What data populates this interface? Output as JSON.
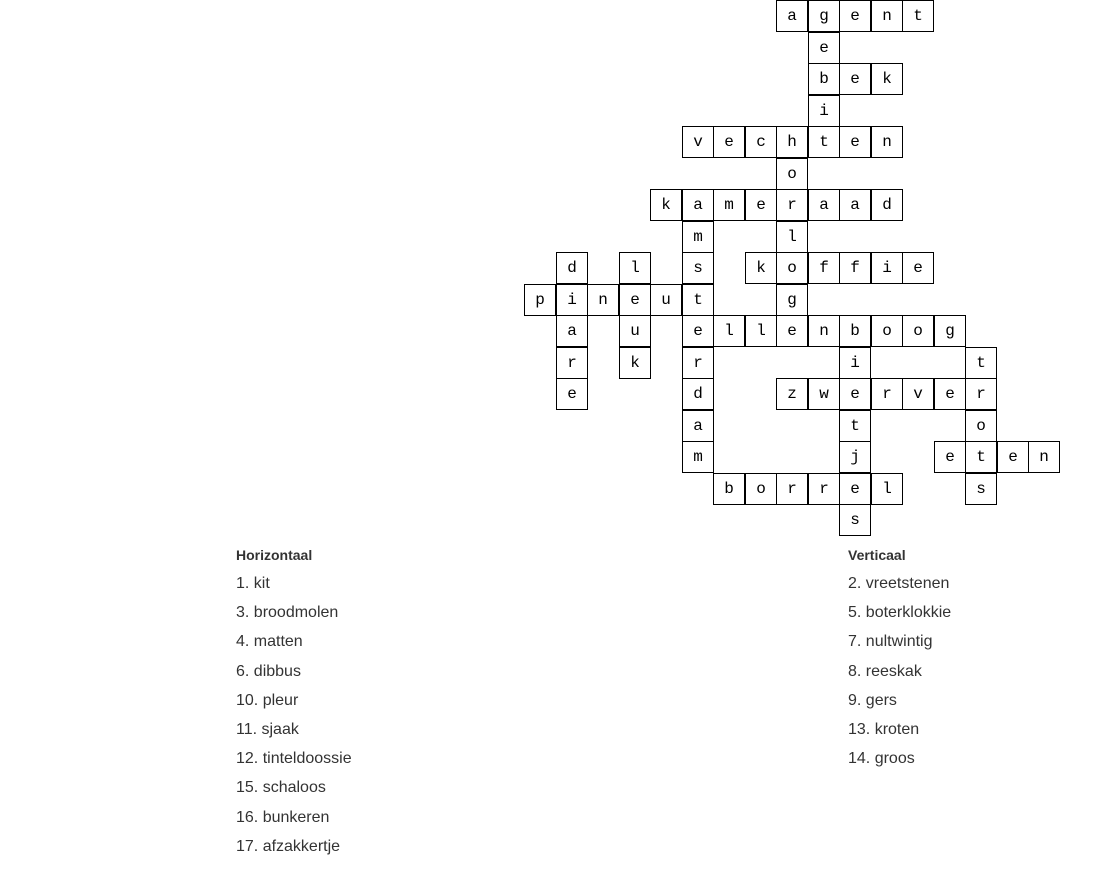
{
  "crossword": {
    "cells": [
      {
        "r": 0,
        "c": 8,
        "letter": "a"
      },
      {
        "r": 0,
        "c": 9,
        "letter": "g"
      },
      {
        "r": 0,
        "c": 10,
        "letter": "e"
      },
      {
        "r": 0,
        "c": 11,
        "letter": "n"
      },
      {
        "r": 0,
        "c": 12,
        "letter": "t"
      },
      {
        "r": 1,
        "c": 9,
        "letter": "e"
      },
      {
        "r": 2,
        "c": 9,
        "letter": "b"
      },
      {
        "r": 2,
        "c": 10,
        "letter": "e"
      },
      {
        "r": 2,
        "c": 11,
        "letter": "k"
      },
      {
        "r": 3,
        "c": 9,
        "letter": "i"
      },
      {
        "r": 4,
        "c": 5,
        "letter": "v"
      },
      {
        "r": 4,
        "c": 6,
        "letter": "e"
      },
      {
        "r": 4,
        "c": 7,
        "letter": "c"
      },
      {
        "r": 4,
        "c": 8,
        "letter": "h"
      },
      {
        "r": 4,
        "c": 9,
        "letter": "t"
      },
      {
        "r": 4,
        "c": 10,
        "letter": "e"
      },
      {
        "r": 4,
        "c": 11,
        "letter": "n"
      },
      {
        "r": 5,
        "c": 8,
        "letter": "o"
      },
      {
        "r": 6,
        "c": 4,
        "letter": "k"
      },
      {
        "r": 6,
        "c": 5,
        "letter": "a"
      },
      {
        "r": 6,
        "c": 6,
        "letter": "m"
      },
      {
        "r": 6,
        "c": 7,
        "letter": "e"
      },
      {
        "r": 6,
        "c": 8,
        "letter": "r"
      },
      {
        "r": 6,
        "c": 9,
        "letter": "a"
      },
      {
        "r": 6,
        "c": 10,
        "letter": "a"
      },
      {
        "r": 6,
        "c": 11,
        "letter": "d"
      },
      {
        "r": 7,
        "c": 5,
        "letter": "m"
      },
      {
        "r": 7,
        "c": 8,
        "letter": "l"
      },
      {
        "r": 8,
        "c": 1,
        "letter": "d"
      },
      {
        "r": 8,
        "c": 3,
        "letter": "l"
      },
      {
        "r": 8,
        "c": 5,
        "letter": "s"
      },
      {
        "r": 8,
        "c": 7,
        "letter": "k"
      },
      {
        "r": 8,
        "c": 8,
        "letter": "o"
      },
      {
        "r": 8,
        "c": 9,
        "letter": "f"
      },
      {
        "r": 8,
        "c": 10,
        "letter": "f"
      },
      {
        "r": 8,
        "c": 11,
        "letter": "i"
      },
      {
        "r": 8,
        "c": 12,
        "letter": "e"
      },
      {
        "r": 9,
        "c": 0,
        "letter": "p"
      },
      {
        "r": 9,
        "c": 1,
        "letter": "i"
      },
      {
        "r": 9,
        "c": 2,
        "letter": "n"
      },
      {
        "r": 9,
        "c": 3,
        "letter": "e"
      },
      {
        "r": 9,
        "c": 4,
        "letter": "u"
      },
      {
        "r": 9,
        "c": 5,
        "letter": "t"
      },
      {
        "r": 9,
        "c": 8,
        "letter": "g"
      },
      {
        "r": 10,
        "c": 1,
        "letter": "a"
      },
      {
        "r": 10,
        "c": 3,
        "letter": "u"
      },
      {
        "r": 10,
        "c": 5,
        "letter": "e"
      },
      {
        "r": 10,
        "c": 6,
        "letter": "l"
      },
      {
        "r": 10,
        "c": 7,
        "letter": "l"
      },
      {
        "r": 10,
        "c": 8,
        "letter": "e"
      },
      {
        "r": 10,
        "c": 9,
        "letter": "n"
      },
      {
        "r": 10,
        "c": 10,
        "letter": "b"
      },
      {
        "r": 10,
        "c": 11,
        "letter": "o"
      },
      {
        "r": 10,
        "c": 12,
        "letter": "o"
      },
      {
        "r": 10,
        "c": 13,
        "letter": "g"
      },
      {
        "r": 11,
        "c": 1,
        "letter": "r"
      },
      {
        "r": 11,
        "c": 3,
        "letter": "k"
      },
      {
        "r": 11,
        "c": 5,
        "letter": "r"
      },
      {
        "r": 11,
        "c": 10,
        "letter": "i"
      },
      {
        "r": 11,
        "c": 14,
        "letter": "t"
      },
      {
        "r": 12,
        "c": 1,
        "letter": "e"
      },
      {
        "r": 12,
        "c": 5,
        "letter": "d"
      },
      {
        "r": 12,
        "c": 8,
        "letter": "z"
      },
      {
        "r": 12,
        "c": 9,
        "letter": "w"
      },
      {
        "r": 12,
        "c": 10,
        "letter": "e"
      },
      {
        "r": 12,
        "c": 11,
        "letter": "r"
      },
      {
        "r": 12,
        "c": 12,
        "letter": "v"
      },
      {
        "r": 12,
        "c": 13,
        "letter": "e"
      },
      {
        "r": 12,
        "c": 14,
        "letter": "r"
      },
      {
        "r": 13,
        "c": 5,
        "letter": "a"
      },
      {
        "r": 13,
        "c": 10,
        "letter": "t"
      },
      {
        "r": 13,
        "c": 14,
        "letter": "o"
      },
      {
        "r": 14,
        "c": 5,
        "letter": "m"
      },
      {
        "r": 14,
        "c": 10,
        "letter": "j"
      },
      {
        "r": 14,
        "c": 13,
        "letter": "e"
      },
      {
        "r": 14,
        "c": 14,
        "letter": "t"
      },
      {
        "r": 14,
        "c": 15,
        "letter": "e"
      },
      {
        "r": 14,
        "c": 16,
        "letter": "n"
      },
      {
        "r": 15,
        "c": 6,
        "letter": "b"
      },
      {
        "r": 15,
        "c": 7,
        "letter": "o"
      },
      {
        "r": 15,
        "c": 8,
        "letter": "r"
      },
      {
        "r": 15,
        "c": 9,
        "letter": "r"
      },
      {
        "r": 15,
        "c": 10,
        "letter": "e"
      },
      {
        "r": 15,
        "c": 11,
        "letter": "l"
      },
      {
        "r": 15,
        "c": 14,
        "letter": "s"
      },
      {
        "r": 16,
        "c": 10,
        "letter": "s"
      }
    ]
  },
  "clues": {
    "horizontal": {
      "heading": "Horizontaal",
      "items": [
        "1. kit",
        "3. broodmolen",
        "4. matten",
        "6. dibbus",
        "10. pleur",
        "11. sjaak",
        "12. tinteldoossie",
        "15. schaloos",
        "16. bunkeren",
        "17. afzakkertje"
      ]
    },
    "vertical": {
      "heading": "Verticaal",
      "items": [
        "2. vreetstenen",
        "5. boterklokkie",
        "7. nultwintig",
        "8. reeskak",
        "9. gers",
        "13. kroten",
        "14. groos"
      ]
    }
  }
}
